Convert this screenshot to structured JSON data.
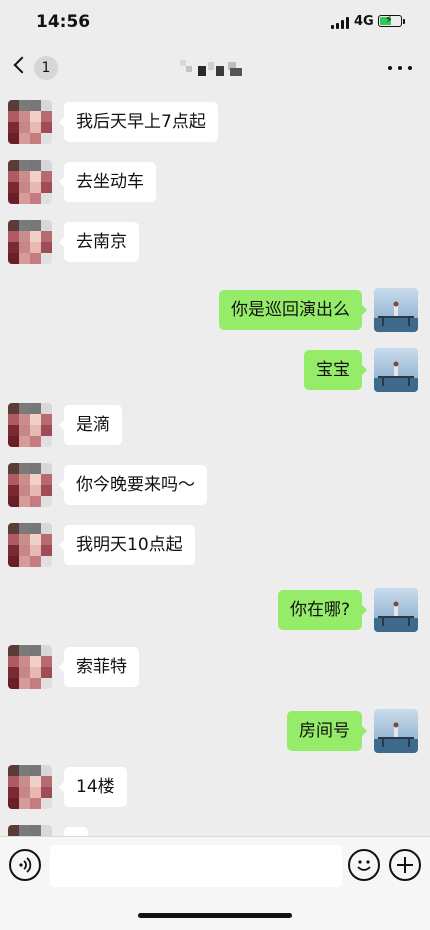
{
  "status_bar": {
    "time": "14:56",
    "network": "4G",
    "battery_level": 0.6,
    "battery_color": "#35c759"
  },
  "nav": {
    "unread_count": "1"
  },
  "colors": {
    "background": "#ededed",
    "incoming_bubble": "#ffffff",
    "outgoing_bubble": "#95ec69"
  },
  "messages": [
    {
      "side": "left",
      "text": "我后天早上7点起"
    },
    {
      "side": "left",
      "text": "去坐动车"
    },
    {
      "side": "left",
      "text": "去南京"
    },
    {
      "side": "right",
      "text": "你是巡回演出么"
    },
    {
      "side": "right",
      "text": "宝宝"
    },
    {
      "side": "left",
      "text": "是滴"
    },
    {
      "side": "left",
      "text": "你今晚要来吗～"
    },
    {
      "side": "left",
      "text": "我明天10点起"
    },
    {
      "side": "right",
      "text": "你在哪?"
    },
    {
      "side": "left",
      "text": "索菲特"
    },
    {
      "side": "right",
      "text": "房间号"
    },
    {
      "side": "left",
      "text": "14楼"
    },
    {
      "side": "left",
      "text": ""
    }
  ],
  "input": {
    "placeholder": ""
  },
  "icons": {
    "voice": "voice-icon",
    "emoji": "emoji-icon",
    "plus": "plus-icon",
    "back": "chevron-left-icon",
    "more": "more-icon"
  }
}
